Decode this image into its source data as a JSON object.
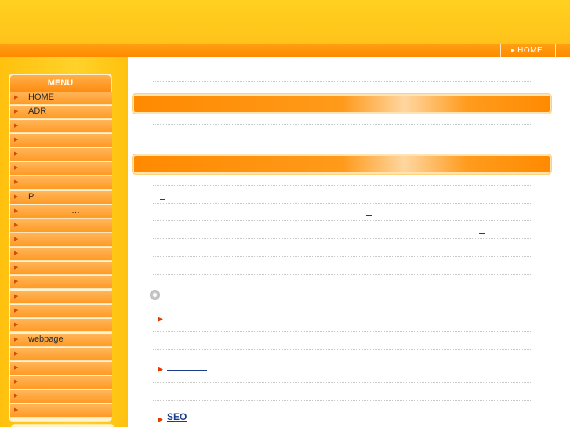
{
  "nav": {
    "home_label": "HOME"
  },
  "sidebar": {
    "menu_title": "MENU",
    "items": [
      {
        "label": "HOME"
      },
      {
        "label": "ADR"
      },
      {
        "label": ""
      },
      {
        "label": ""
      },
      {
        "label": ""
      },
      {
        "label": ""
      },
      {
        "label": ""
      },
      {
        "label": "P"
      },
      {
        "label": "",
        "suffix": "…"
      },
      {
        "label": ""
      },
      {
        "label": ""
      },
      {
        "label": ""
      },
      {
        "label": ""
      },
      {
        "label": ""
      },
      {
        "label": ""
      },
      {
        "label": ""
      },
      {
        "label": ""
      },
      {
        "label": "webpage"
      },
      {
        "label": ""
      },
      {
        "label": ""
      },
      {
        "label": ""
      },
      {
        "label": ""
      },
      {
        "label": ""
      }
    ]
  },
  "main": {
    "links": {
      "seo_label": "SEO"
    }
  }
}
